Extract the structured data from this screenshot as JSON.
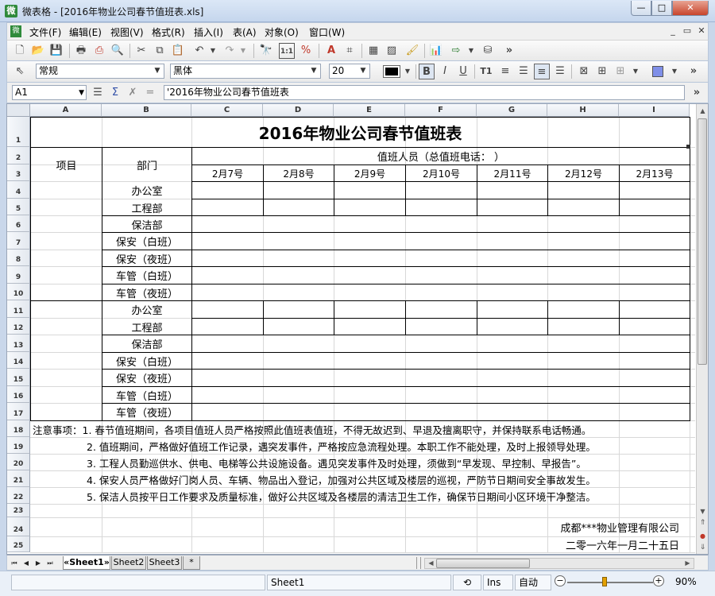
{
  "window": {
    "title": "微表格 - [2016年物业公司春节值班表.xls]",
    "app_icon": "微",
    "buttons": {
      "minimize": "—",
      "maximize": "□",
      "close": "✕"
    }
  },
  "menu": {
    "items": [
      "文件(F)",
      "编辑(E)",
      "视图(V)",
      "格式(R)",
      "插入(I)",
      "表(A)",
      "对象(O)",
      "窗口(W)"
    ],
    "mdi": {
      "minimize": "_",
      "restore": "▭",
      "close": "✕"
    }
  },
  "toolbar": {
    "style": "常规",
    "font": "黑体",
    "size": "20",
    "more": "»"
  },
  "formula_bar": {
    "name_box": "A1",
    "content": "'2016年物业公司春节值班表"
  },
  "columns": [
    "A",
    "B",
    "C",
    "D",
    "E",
    "F",
    "G",
    "H",
    "I"
  ],
  "rows": [
    "1",
    "2",
    "3",
    "4",
    "5",
    "6",
    "7",
    "8",
    "9",
    "10",
    "11",
    "12",
    "13",
    "14",
    "15",
    "16",
    "17",
    "18",
    "19",
    "20",
    "21",
    "22",
    "23",
    "24",
    "25"
  ],
  "sheet": {
    "title": "2016年物业公司春节值班表",
    "project_header": "项目",
    "dept_header": "部门",
    "duty_header": "值班人员（总值班电话：                              ）",
    "dates": [
      "2月7号",
      "2月8号",
      "2月9号",
      "2月10号",
      "2月11号",
      "2月12号",
      "2月13号"
    ],
    "depts": [
      "办公室",
      "工程部",
      "保洁部",
      "保安（白班）",
      "保安（夜班）",
      "车管（白班）",
      "车管（夜班）"
    ],
    "notes": [
      "注意事项：1. 春节值班期间，各项目值班人员严格按照此值班表值班，不得无故迟到、早退及擅离职守，并保持联系电话畅通。",
      "2. 值班期间，严格做好值班工作记录，遇突发事件，严格按应急流程处理。本职工作不能处理，及时上报领导处理。",
      "3. 工程人员勤巡供水、供电、电梯等公共设施设备。遇见突发事件及时处理，须做到“早发现、早控制、早报告”。",
      "4. 保安人员严格做好门岗人员、车辆、物品出入登记，加强对公共区域及楼层的巡视，严防节日期间安全事故发生。",
      "5. 保洁人员按平日工作要求及质量标准，做好公共区域及各楼层的清洁卫生工作，确保节日期间小区环境干净整洁。"
    ],
    "company": "成都***物业管理有限公司",
    "date_sign": "二零一六年一月二十五日"
  },
  "tabs": [
    "«Sheet1»",
    "Sheet2",
    "Sheet3",
    "*"
  ],
  "statusbar": {
    "sheet": "Sheet1",
    "mode": "Ins",
    "auto": "自动",
    "zoom": "90%"
  },
  "colors": {
    "window_bg": "#c9d7ea",
    "close": "#c8442b",
    "grid_line": "#d8d8d8",
    "border": "#000000"
  }
}
